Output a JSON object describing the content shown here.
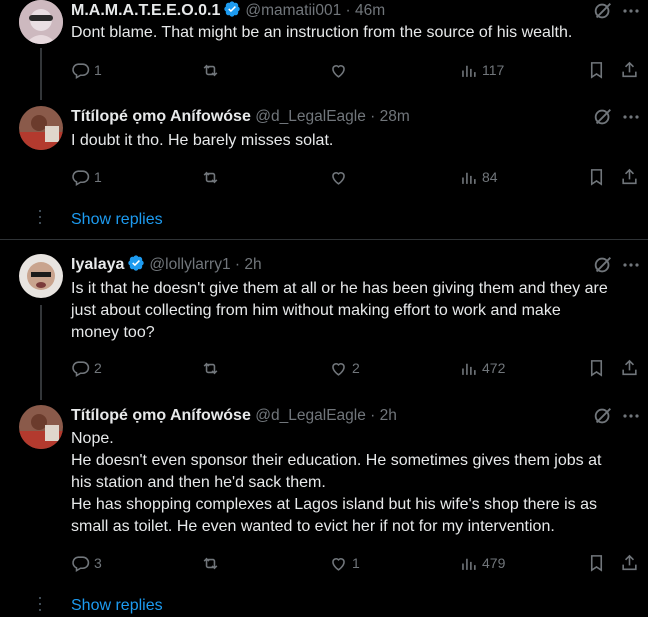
{
  "tweets": [
    {
      "name": "M.A.M.A.T.E.E.O.0.1",
      "verified": true,
      "handle": "@mamatii001 · 46m",
      "lines": [
        "Dont blame. That might be an instruction from the source of his wealth."
      ],
      "replies": "1",
      "retweets": "",
      "likes": "",
      "views": "117"
    },
    {
      "name": "Títílopé ọmọ Anífowóse",
      "verified": false,
      "handle": "@d_LegalEagle · 28m",
      "lines": [
        "I doubt it tho. He barely misses solat."
      ],
      "replies": "1",
      "retweets": "",
      "likes": "",
      "views": "84"
    },
    {
      "name": "Iyalaya",
      "verified": true,
      "handle": "@lollylarry1 · 2h",
      "lines": [
        "Is it that he doesn't give them at all or he has been giving them and they are",
        "just about collecting from him without making effort to work and make",
        "money too?"
      ],
      "replies": "2",
      "retweets": "",
      "likes": "2",
      "views": "472"
    },
    {
      "name": "Títílopé ọmọ Anífowóse",
      "verified": false,
      "handle": "@d_LegalEagle · 2h",
      "lines": [
        "Nope.",
        "He doesn't even sponsor their education. He sometimes gives them jobs at",
        "his station and then he'd sack them.",
        "He has shopping complexes at Lagos island but his wife's shop there is as",
        "small as toilet. He even wanted to evict her if not for my intervention."
      ],
      "replies": "3",
      "retweets": "",
      "likes": "1",
      "views": "479"
    }
  ],
  "show_replies_label": "Show replies",
  "colors": {
    "accent": "#1d9bf0",
    "muted": "#71767b",
    "background": "#000000"
  },
  "icons": [
    "reply-icon",
    "retweet-icon",
    "like-icon",
    "views-icon",
    "bookmark-icon",
    "share-icon",
    "grok-icon",
    "more-icon",
    "verified-badge-icon"
  ]
}
